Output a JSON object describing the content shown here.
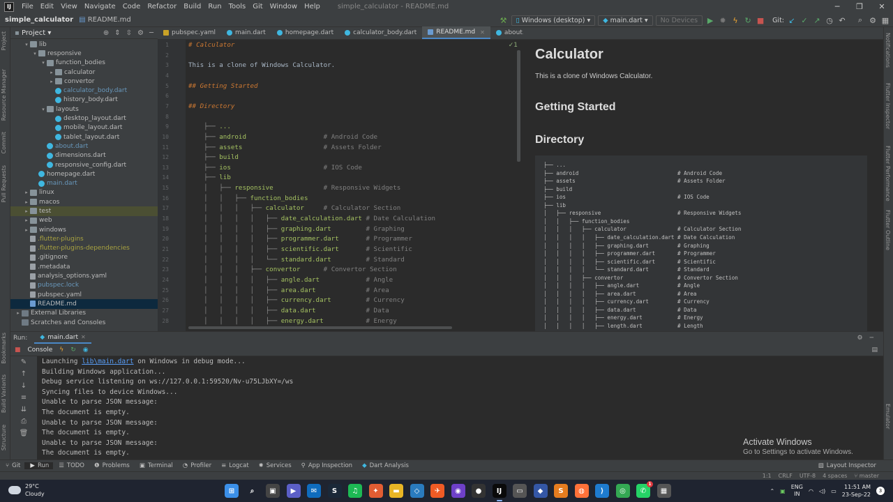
{
  "menubar": {
    "items": [
      "File",
      "Edit",
      "View",
      "Navigate",
      "Code",
      "Refactor",
      "Build",
      "Run",
      "Tools",
      "Git",
      "Window",
      "Help"
    ],
    "window_title": "simple_calculator - README.md"
  },
  "navbar": {
    "project": "simple_calculator",
    "file": "README.md",
    "device": "Windows (desktop)",
    "run_config": "main.dart",
    "devices_placeholder": "No Devices",
    "git_label": "Git:"
  },
  "project_panel": {
    "title": "Project",
    "tree": [
      {
        "label": "lib",
        "depth": 1,
        "type": "folder",
        "arrow": "▾"
      },
      {
        "label": "responsive",
        "depth": 2,
        "type": "folder",
        "arrow": "▾"
      },
      {
        "label": "function_bodies",
        "depth": 3,
        "type": "folder",
        "arrow": "▾"
      },
      {
        "label": "calculator",
        "depth": 4,
        "type": "folder",
        "arrow": "▸"
      },
      {
        "label": "convertor",
        "depth": 4,
        "type": "folder",
        "arrow": "▸"
      },
      {
        "label": "calculator_body.dart",
        "depth": 4,
        "type": "dart",
        "color": "blue"
      },
      {
        "label": "history_body.dart",
        "depth": 4,
        "type": "dart"
      },
      {
        "label": "layouts",
        "depth": 3,
        "type": "folder",
        "arrow": "▾"
      },
      {
        "label": "desktop_layout.dart",
        "depth": 4,
        "type": "dart"
      },
      {
        "label": "mobile_layout.dart",
        "depth": 4,
        "type": "dart"
      },
      {
        "label": "tablet_layout.dart",
        "depth": 4,
        "type": "dart"
      },
      {
        "label": "about.dart",
        "depth": 3,
        "type": "dart",
        "color": "blue"
      },
      {
        "label": "dimensions.dart",
        "depth": 3,
        "type": "dart"
      },
      {
        "label": "responsive_config.dart",
        "depth": 3,
        "type": "dart"
      },
      {
        "label": "homepage.dart",
        "depth": 2,
        "type": "dart"
      },
      {
        "label": "main.dart",
        "depth": 2,
        "type": "dart",
        "color": "blue"
      },
      {
        "label": "linux",
        "depth": 1,
        "type": "folder",
        "arrow": "▸"
      },
      {
        "label": "macos",
        "depth": 1,
        "type": "folder",
        "arrow": "▸"
      },
      {
        "label": "test",
        "depth": 1,
        "type": "folder",
        "arrow": "▸",
        "hl": true
      },
      {
        "label": "web",
        "depth": 1,
        "type": "folder",
        "arrow": "▸"
      },
      {
        "label": "windows",
        "depth": 1,
        "type": "folder",
        "arrow": "▸"
      },
      {
        "label": ".flutter-plugins",
        "depth": 1,
        "type": "file",
        "color": "yellow"
      },
      {
        "label": ".flutter-plugins-dependencies",
        "depth": 1,
        "type": "file",
        "color": "yellow"
      },
      {
        "label": ".gitignore",
        "depth": 1,
        "type": "file"
      },
      {
        "label": ".metadata",
        "depth": 1,
        "type": "file"
      },
      {
        "label": "analysis_options.yaml",
        "depth": 1,
        "type": "file"
      },
      {
        "label": "pubspec.lock",
        "depth": 1,
        "type": "file",
        "color": "blue"
      },
      {
        "label": "pubspec.yaml",
        "depth": 1,
        "type": "file"
      },
      {
        "label": "README.md",
        "depth": 1,
        "type": "md",
        "sel": true
      },
      {
        "label": "External Libraries",
        "depth": 0,
        "type": "lib",
        "arrow": "▸"
      },
      {
        "label": "Scratches and Consoles",
        "depth": 0,
        "type": "lib"
      }
    ]
  },
  "tabs": [
    {
      "label": "pubspec.yaml",
      "kind": "y"
    },
    {
      "label": "main.dart",
      "kind": "d"
    },
    {
      "label": "homepage.dart",
      "kind": "d"
    },
    {
      "label": "calculator_body.dart",
      "kind": "d"
    },
    {
      "label": "README.md",
      "kind": "m",
      "active": true
    },
    {
      "label": "about.dart",
      "kind": "d"
    }
  ],
  "editor": {
    "check": "✓1",
    "lines": [
      {
        "n": "1",
        "text": "# Calculator",
        "kind": "head"
      },
      {
        "n": "2",
        "text": ""
      },
      {
        "n": "3",
        "text": "This is a clone of Windows Calculator."
      },
      {
        "n": "4",
        "text": ""
      },
      {
        "n": "5",
        "text": "## Getting Started",
        "kind": "head"
      },
      {
        "n": "6",
        "text": ""
      },
      {
        "n": "7",
        "text": "## Directory",
        "kind": "head"
      },
      {
        "n": "8",
        "text": ""
      },
      {
        "n": "9",
        "tree": "    ├── ",
        "name": "...",
        "cmt": ""
      },
      {
        "n": "10",
        "tree": "    ├── ",
        "name": "android",
        "cmt": "                    # Android Code"
      },
      {
        "n": "11",
        "tree": "    ├── ",
        "name": "assets",
        "cmt": "                     # Assets Folder"
      },
      {
        "n": "12",
        "tree": "    ├── ",
        "name": "build",
        "cmt": ""
      },
      {
        "n": "13",
        "tree": "    ├── ",
        "name": "ios",
        "cmt": "                        # IOS Code"
      },
      {
        "n": "14",
        "tree": "    ├── ",
        "name": "lib",
        "cmt": ""
      },
      {
        "n": "15",
        "tree": "    │   ├── ",
        "name": "responsive",
        "cmt": "             # Responsive Widgets"
      },
      {
        "n": "16",
        "tree": "    │   │   ├── ",
        "name": "function_bodies",
        "cmt": ""
      },
      {
        "n": "17",
        "tree": "    │   │   │   ├── ",
        "name": "calculator",
        "cmt": "     # Calculator Section"
      },
      {
        "n": "18",
        "tree": "    │   │   │   │   ├── ",
        "name": "date_calculation.dart",
        "cmt": " # Date Calculation"
      },
      {
        "n": "19",
        "tree": "    │   │   │   │   ├── ",
        "name": "graphing.dart",
        "cmt": "         # Graphing"
      },
      {
        "n": "20",
        "tree": "    │   │   │   │   ├── ",
        "name": "programmer.dart",
        "cmt": "       # Programmer"
      },
      {
        "n": "21",
        "tree": "    │   │   │   │   ├── ",
        "name": "scientific.dart",
        "cmt": "       # Scientific"
      },
      {
        "n": "22",
        "tree": "    │   │   │   │   └── ",
        "name": "standard.dart",
        "cmt": "         # Standard"
      },
      {
        "n": "23",
        "tree": "    │   │   │   ├── ",
        "name": "convertor",
        "cmt": "      # Convertor Section"
      },
      {
        "n": "24",
        "tree": "    │   │   │   │   ├── ",
        "name": "angle.dart",
        "cmt": "            # Angle"
      },
      {
        "n": "25",
        "tree": "    │   │   │   │   ├── ",
        "name": "area.dart",
        "cmt": "             # Area"
      },
      {
        "n": "26",
        "tree": "    │   │   │   │   ├── ",
        "name": "currency.dart",
        "cmt": "         # Currency"
      },
      {
        "n": "27",
        "tree": "    │   │   │   │   ├── ",
        "name": "data.dart",
        "cmt": "             # Data"
      },
      {
        "n": "28",
        "tree": "    │   │   │   │   ├── ",
        "name": "energy.dart",
        "cmt": "           # Energy"
      }
    ]
  },
  "preview": {
    "h1": "Calculator",
    "intro": "This is a clone of Windows Calculator.",
    "h2_started": "Getting Started",
    "h2_directory": "Directory",
    "pre": [
      "├── ...",
      "├── android                               # Android Code",
      "├── assets                                # Assets Folder",
      "├── build",
      "├── ios                                   # IOS Code",
      "├── lib",
      "│   ├── responsive                        # Responsive Widgets",
      "│   │   ├── function_bodies",
      "│   │   │   ├── calculator                # Calculator Section",
      "│   │   │   │   ├── date_calculation.dart # Date Calculation",
      "│   │   │   │   ├── graphing.dart         # Graphing",
      "│   │   │   │   ├── programmer.dart       # Programmer",
      "│   │   │   │   ├── scientific.dart       # Scientific",
      "│   │   │   │   └── standard.dart         # Standard",
      "│   │   │   ├── convertor                 # Convertor Section",
      "│   │   │   │   ├── angle.dart            # Angle",
      "│   │   │   │   ├── area.dart             # Area",
      "│   │   │   │   ├── currency.dart         # Currency",
      "│   │   │   │   ├── data.dart             # Data",
      "│   │   │   │   ├── energy.dart           # Energy",
      "│   │   │   │   ├── length.dart           # Length"
    ]
  },
  "run": {
    "label": "Run:",
    "config": "main.dart",
    "console_tab": "Console",
    "lines": [
      {
        "pre": "Launching ",
        "link": "lib\\main.dart",
        "post": " on Windows in debug mode..."
      },
      {
        "pre": "Building Windows application..."
      },
      {
        "pre": "Debug service listening on ws://127.0.0.1:59520/Nv-u75LJbXY=/ws"
      },
      {
        "pre": "Syncing files to device Windows..."
      },
      {
        "pre": "Unable to parse JSON message:"
      },
      {
        "pre": "The document is empty."
      },
      {
        "pre": "Unable to parse JSON message:"
      },
      {
        "pre": "The document is empty."
      },
      {
        "pre": "Unable to parse JSON message:"
      },
      {
        "pre": "The document is empty."
      }
    ]
  },
  "activation": {
    "title": "Activate Windows",
    "subtitle": "Go to Settings to activate Windows."
  },
  "bottom_tools": [
    "Git",
    "Run",
    "TODO",
    "Problems",
    "Terminal",
    "Profiler",
    "Logcat",
    "Services",
    "App Inspection",
    "Dart Analysis"
  ],
  "layout_inspector": "Layout Inspector",
  "status": {
    "position": "1:1",
    "line_sep": "CRLF",
    "encoding": "UTF-8",
    "indent": "4 spaces",
    "branch": "master"
  },
  "left_strip": [
    "Project",
    "Resource Manager",
    "Commit",
    "Pull Requests",
    "Bookmarks",
    "Build Variants",
    "Structure"
  ],
  "right_strip": [
    "Notifications",
    "Flutter Inspector",
    "Flutter Performance",
    "Flutter Outline",
    "Emulator"
  ],
  "taskbar": {
    "temp": "29°C",
    "weather": "Cloudy",
    "lang1": "ENG",
    "lang2": "IN",
    "time": "11:51 AM",
    "date": "23-Sep-22",
    "icons": [
      {
        "name": "windows-start-icon",
        "color": "#3b8fe8",
        "glyph": "⊞"
      },
      {
        "name": "search-icon",
        "color": "transparent",
        "glyph": "⌕"
      },
      {
        "name": "task-view-icon",
        "color": "#444",
        "glyph": "▣"
      },
      {
        "name": "teams-chat-icon",
        "color": "#5b5fc7",
        "glyph": "▶"
      },
      {
        "name": "mail-icon",
        "color": "#0f6cbd",
        "glyph": "✉"
      },
      {
        "name": "steam-icon",
        "color": "#1b2838",
        "glyph": "S"
      },
      {
        "name": "spotify-icon",
        "color": "#1db954",
        "glyph": "♫"
      },
      {
        "name": "app-orange-icon",
        "color": "#e25d33",
        "glyph": "✦"
      },
      {
        "name": "file-explorer-icon",
        "color": "#e8b525",
        "glyph": "▬"
      },
      {
        "name": "network-icon",
        "color": "#2a7bbf",
        "glyph": "◇"
      },
      {
        "name": "postman-icon",
        "color": "#ef5b25",
        "glyph": "✈"
      },
      {
        "name": "github-icon",
        "color": "#6e40c9",
        "glyph": "◉"
      },
      {
        "name": "obs-icon",
        "color": "#333",
        "glyph": "●"
      },
      {
        "name": "intellij-icon",
        "color": "#0a0a0a",
        "glyph": "IJ",
        "active": true
      },
      {
        "name": "app-pill-icon",
        "color": "#555",
        "glyph": "▭"
      },
      {
        "name": "brave-icon",
        "color": "#3457a6",
        "glyph": "◆"
      },
      {
        "name": "sublime-icon",
        "color": "#e57c1f",
        "glyph": "S"
      },
      {
        "name": "firefox-icon",
        "color": "#ff7139",
        "glyph": "◍"
      },
      {
        "name": "vscode-icon",
        "color": "#1e7bd0",
        "glyph": "⟩"
      },
      {
        "name": "chrome-icon",
        "color": "#34a853",
        "glyph": "◎"
      },
      {
        "name": "whatsapp-icon",
        "color": "#25d366",
        "glyph": "✆",
        "badge": "1"
      },
      {
        "name": "calculator-icon",
        "color": "#555",
        "glyph": "▦"
      }
    ]
  }
}
